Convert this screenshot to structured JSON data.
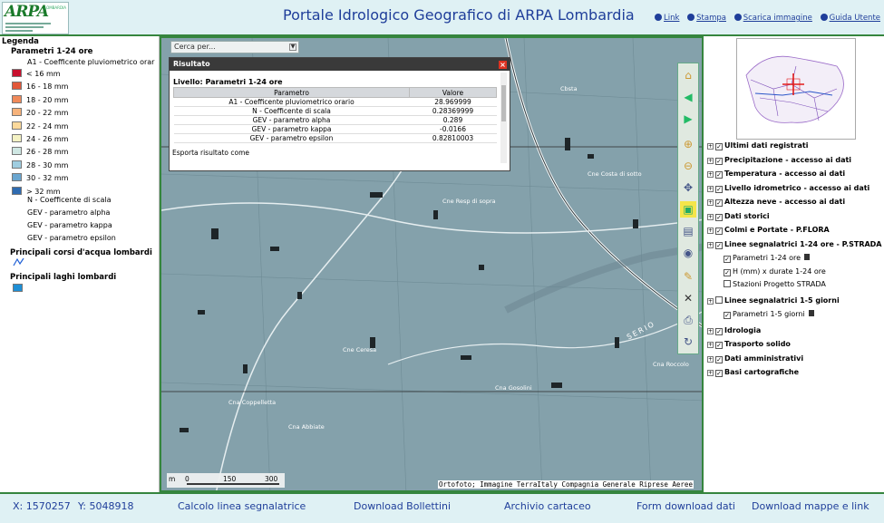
{
  "header": {
    "logo_text": "ARPA",
    "logo_tag": "LOMBARDIA",
    "title": "Portale Idrologico Geografico di ARPA Lombardia",
    "links": [
      "Link",
      "Stampa",
      "Scarica immagine",
      "Guida Utente"
    ]
  },
  "legend": {
    "title": "Legenda",
    "section_title": "Parametri 1-24 ore",
    "param_label": "A1 - Coefficente pluviometrico orar",
    "classes": [
      {
        "label": "< 16 mm",
        "color": "#c8102e"
      },
      {
        "label": "16 - 18 mm",
        "color": "#e2583a"
      },
      {
        "label": "18 - 20 mm",
        "color": "#f08a5a"
      },
      {
        "label": "20 - 22 mm",
        "color": "#f6b27a"
      },
      {
        "label": "22 - 24 mm",
        "color": "#fbd99b"
      },
      {
        "label": "24 - 26 mm",
        "color": "#f4f2c4"
      },
      {
        "label": "26 - 28 mm",
        "color": "#cfe7e3"
      },
      {
        "label": "28 - 30 mm",
        "color": "#9fcde0"
      },
      {
        "label": "30 - 32 mm",
        "color": "#6aa6d0"
      },
      {
        "label": "> 32 mm",
        "color": "#2f6bb0"
      }
    ],
    "other_params": [
      "N - Coefficente di scala",
      "GEV - parametro alpha",
      "GEV - parametro kappa",
      "GEV - parametro epsilon"
    ],
    "rivers_title": "Principali corsi d'acqua lombardi",
    "lakes_title": "Principali laghi lombardi",
    "lake_color": "#1e8fd6"
  },
  "map": {
    "search_placeholder": "Cerca per...",
    "result": {
      "title": "Risultato",
      "level": "Livello: Parametri 1-24 ore",
      "col_param": "Parametro",
      "col_value": "Valore",
      "rows": [
        {
          "param": "A1 - Coefficente pluviometrico orario",
          "value": "28.969999"
        },
        {
          "param": "N - Coefficente di scala",
          "value": "0.28369999"
        },
        {
          "param": "GEV - parametro alpha",
          "value": "0.289"
        },
        {
          "param": "GEV - parametro kappa",
          "value": "-0.0166"
        },
        {
          "param": "GEV - parametro epsilon",
          "value": "0.82810003"
        }
      ],
      "export": "Esporta risultato come"
    },
    "places": [
      "Cbsta",
      "Cne Costa di sotto",
      "Cne Resp di sopra",
      "Cne Ceresa",
      "Cna Gosolini",
      "Cna Coppelletta",
      "Cna Abbiate",
      "Cna Roccolo",
      "SERIO"
    ],
    "scale_labels": [
      "m",
      "0",
      "150",
      "300"
    ],
    "attribution": "Ortofoto; Immagine TerraItaly Compagnia Generale Riprese Aeree"
  },
  "tree": [
    {
      "label": "Ultimi dati registrati",
      "level": 0
    },
    {
      "label": "Precipitazione - accesso ai dati",
      "level": 0
    },
    {
      "label": "Temperatura - accesso ai dati",
      "level": 0
    },
    {
      "label": "Livello idrometrico - accesso ai dati",
      "level": 0
    },
    {
      "label": "Altezza neve - accesso ai dati",
      "level": 0
    },
    {
      "label": "Dati storici",
      "level": 0
    },
    {
      "label": "Colmi e Portate - P.FLORA",
      "level": 0
    },
    {
      "label": "Linee segnalatrici 1-24 ore - P.STRADA",
      "level": 0
    },
    {
      "label": "Parametri 1-24 ore",
      "level": 1
    },
    {
      "label": "H (mm) x durate 1-24 ore",
      "level": 1
    },
    {
      "label": "Stazioni Progetto STRADA",
      "level": 1
    },
    {
      "label": "Linee segnalatrici 1-5 giorni",
      "level": 0
    },
    {
      "label": "Parametri 1-5 giorni",
      "level": 1
    },
    {
      "label": "Idrologia",
      "level": 0
    },
    {
      "label": "Trasporto solido",
      "level": 0
    },
    {
      "label": "Dati amministrativi",
      "level": 0
    },
    {
      "label": "Basi cartografiche",
      "level": 0
    }
  ],
  "footer": {
    "x_label": "X: 1570257",
    "y_label": "Y: 5048918",
    "links": [
      "Calcolo linea segnalatrice",
      "Download Bollettini",
      "Archivio cartaceo",
      "Form download dati",
      "Download mappe e link"
    ]
  }
}
